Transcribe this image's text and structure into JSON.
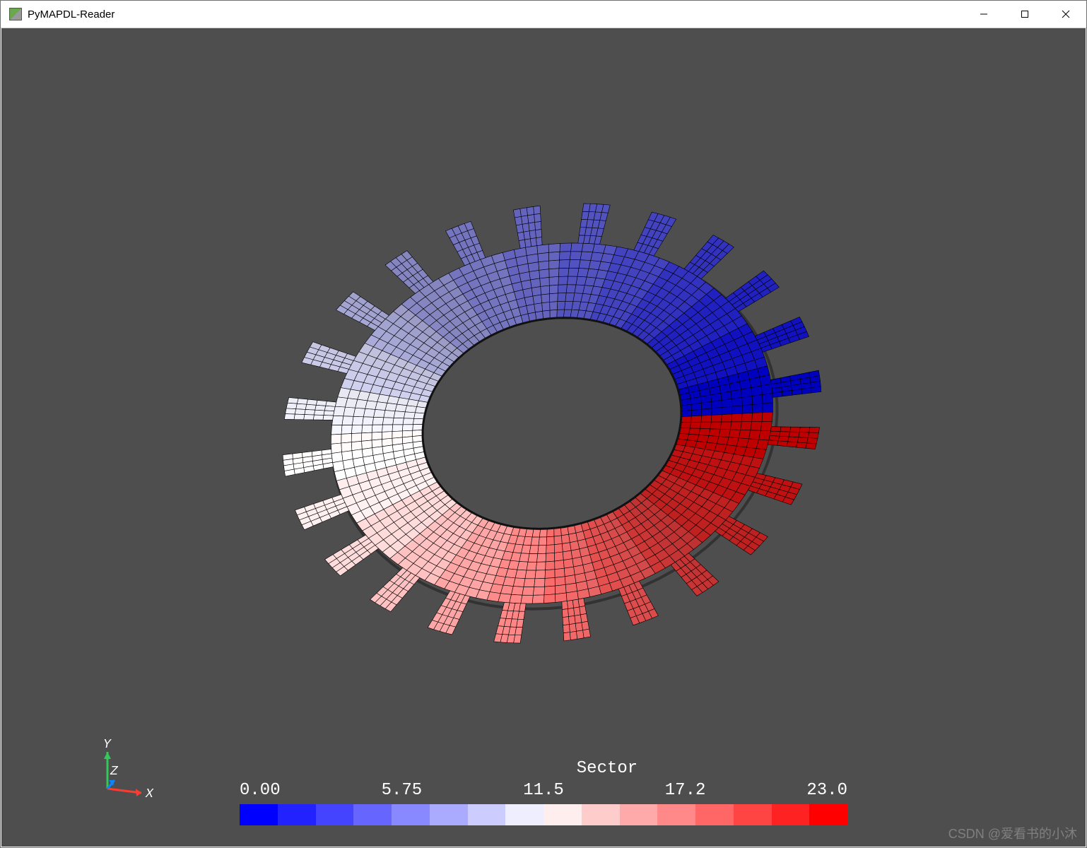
{
  "window": {
    "title": "PyMAPDL-Reader"
  },
  "axes": {
    "y": "Y",
    "z": "Z",
    "x": "X"
  },
  "scalar_bar": {
    "title": "Sector",
    "ticks": [
      "0.00",
      "5.75",
      "11.5",
      "17.2",
      "23.0"
    ]
  },
  "watermark": "CSDN @爱看书的小沐",
  "chart_data": {
    "type": "heatmap",
    "title": "Sector",
    "dataset": "Cyclic rotor mesh with 24 sectors, scalar = sector index",
    "colormap": "bwr",
    "range": [
      0.0,
      23.0
    ],
    "ticks": [
      0.0,
      5.75,
      11.5,
      17.2,
      23.0
    ],
    "n_sectors": 24,
    "sector_values": [
      0,
      1,
      2,
      3,
      4,
      5,
      6,
      7,
      8,
      9,
      10,
      11,
      12,
      13,
      14,
      15,
      16,
      17,
      18,
      19,
      20,
      21,
      22,
      23
    ],
    "geometry": {
      "inner_radius_fraction": 0.48,
      "outer_radius_fraction": 0.82,
      "tooth_outer_fraction": 1.0,
      "teeth": 24,
      "mesh_rings": 9,
      "mesh_cols_per_sector": 5,
      "tooth_grid": [
        5,
        4
      ]
    },
    "colormap_stops": [
      {
        "t": 0.0,
        "hex": "#0000ff"
      },
      {
        "t": 0.1,
        "hex": "#3333ff"
      },
      {
        "t": 0.2,
        "hex": "#6666ff"
      },
      {
        "t": 0.3,
        "hex": "#9999ff"
      },
      {
        "t": 0.4,
        "hex": "#ccccff"
      },
      {
        "t": 0.5,
        "hex": "#ffffff"
      },
      {
        "t": 0.6,
        "hex": "#ffcccc"
      },
      {
        "t": 0.7,
        "hex": "#ff9999"
      },
      {
        "t": 0.8,
        "hex": "#ff6666"
      },
      {
        "t": 0.9,
        "hex": "#ff3333"
      },
      {
        "t": 1.0,
        "hex": "#ff0000"
      }
    ]
  }
}
